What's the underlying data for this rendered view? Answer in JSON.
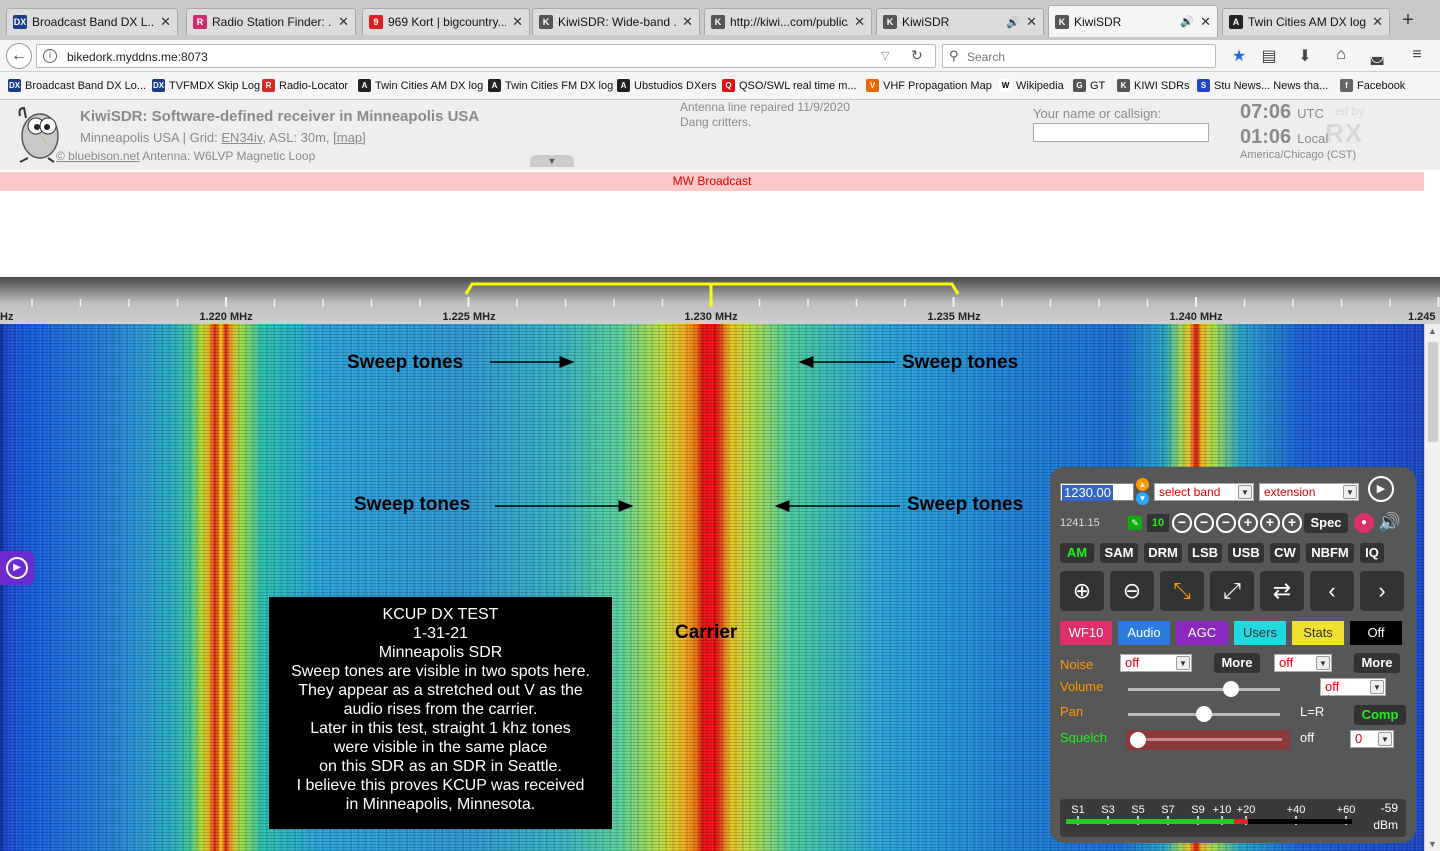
{
  "browser": {
    "tabs": [
      {
        "title": "Broadcast Band DX L...",
        "icon_color": "#1a3e8a",
        "icon_glyph": "DX"
      },
      {
        "title": "Radio Station Finder: ...",
        "icon_color": "#d02a6a",
        "icon_glyph": "R"
      },
      {
        "title": "969 Kort | bigcountry...",
        "icon_color": "#e02020",
        "icon_glyph": "9"
      },
      {
        "title": "KiwiSDR: Wide-band ...",
        "icon_color": "#555555",
        "icon_glyph": "K"
      },
      {
        "title": "http://kiwi...com/public/",
        "icon_color": "#555555",
        "icon_glyph": "K"
      },
      {
        "title": "KiwiSDR",
        "icon_color": "#555555",
        "icon_glyph": "K",
        "audio": true
      },
      {
        "title": "KiwiSDR",
        "icon_color": "#555555",
        "icon_glyph": "K",
        "audio": true,
        "active": true
      },
      {
        "title": "Twin Cities AM DX log",
        "icon_color": "#222222",
        "icon_glyph": "A"
      }
    ],
    "url": "bikedork.myddns.me:8073",
    "search_placeholder": "Search",
    "bookmarks": [
      {
        "label": "Broadcast Band DX Lo...",
        "icon_color": "#1a3e8a",
        "icon_glyph": "DX"
      },
      {
        "label": "TVFMDX Skip Log",
        "icon_color": "#1a3e8a",
        "icon_glyph": "DX"
      },
      {
        "label": "Radio-Locator",
        "icon_color": "#d02a2a",
        "icon_glyph": "R"
      },
      {
        "label": "Twin Cities AM DX log",
        "icon_color": "#222222",
        "icon_glyph": "A"
      },
      {
        "label": "Twin Cities FM DX log",
        "icon_color": "#222222",
        "icon_glyph": "A"
      },
      {
        "label": "Ubstudios DXers",
        "icon_color": "#222222",
        "icon_glyph": "A"
      },
      {
        "label": "QSO/SWL real time m...",
        "icon_color": "#dd1111",
        "icon_glyph": "Q"
      },
      {
        "label": "VHF Propagation Map",
        "icon_color": "#ee6600",
        "icon_glyph": "V"
      },
      {
        "label": "Wikipedia",
        "icon_color": "#ffffff",
        "icon_glyph": "W"
      },
      {
        "label": "GT",
        "icon_color": "#555555",
        "icon_glyph": "G"
      },
      {
        "label": "KIWI SDRs",
        "icon_color": "#555555",
        "icon_glyph": "K"
      },
      {
        "label": "Stu News... News tha...",
        "icon_color": "#2244cc",
        "icon_glyph": "S"
      },
      {
        "label": "Facebook",
        "icon_color": "#666666",
        "icon_glyph": "f"
      }
    ]
  },
  "kiwi": {
    "title": "KiwiSDR: Software-defined receiver in Minneapolis USA",
    "loc_prefix": "Minneapolis USA | Grid: ",
    "grid": "EN34iv",
    "asl": ", ASL: 30m, ",
    "map_link": "[map]",
    "copyright": "© bluebison.net",
    "antenna": " Antenna: W6LVP Magnetic Loop",
    "note_line1": "Antenna line repaired 11/9/2020",
    "note_line2": "Dang critters.",
    "name_label": "Your name or callsign:",
    "utc_time": "07:06",
    "utc_label": "UTC",
    "local_time": "01:06",
    "local_label": "Local",
    "timezone": "America/Chicago (CST)",
    "openrx_by": "ed by",
    "openrx_logo": "RX",
    "band_label": "MW Broadcast"
  },
  "scale": {
    "labels": [
      {
        "text": "Hz"
      },
      {
        "text": "1.220 MHz"
      },
      {
        "text": "1.225 MHz"
      },
      {
        "text": "1.230 MHz"
      },
      {
        "text": "1.235 MHz"
      },
      {
        "text": "1.240 MHz"
      },
      {
        "text": "1.245"
      }
    ]
  },
  "annotations": {
    "sweep_1": "Sweep tones",
    "sweep_2": "Sweep tones",
    "sweep_3": "Sweep tones",
    "sweep_4": "Sweep tones",
    "carrier": "Carrier",
    "box_lines": [
      "KCUP DX TEST",
      "1-31-21",
      "Minneapolis SDR",
      "Sweep tones are visible in two spots here.",
      "They appear as a stretched out V as the",
      "audio rises from the carrier.",
      "Later in this test, straight 1 khz tones",
      "were visible in the same place",
      "on this SDR as an SDR in Seattle.",
      "I believe this proves KCUP was received",
      "in Minneapolis, Minnesota."
    ]
  },
  "panel": {
    "frequency": "1230.00",
    "select_band": "select band",
    "extension": "extension",
    "freq2": "1241.15",
    "zoom_level": "10",
    "spec": "Spec",
    "modes": [
      "AM",
      "SAM",
      "DRM",
      "LSB",
      "USB",
      "CW",
      "NBFM",
      "IQ"
    ],
    "active_mode": "AM",
    "tabs": [
      {
        "label": "WF10",
        "bg": "#e0306a",
        "fg": "#ffffff"
      },
      {
        "label": "Audio",
        "bg": "#2a7ae0",
        "fg": "#ffffff"
      },
      {
        "label": "AGC",
        "bg": "#8a28c0",
        "fg": "#ffffff"
      },
      {
        "label": "Users",
        "bg": "#22d8e0",
        "fg": "#333333"
      },
      {
        "label": "Stats",
        "bg": "#f0e030",
        "fg": "#333333"
      },
      {
        "label": "Off",
        "bg": "#000000",
        "fg": "#ffffff"
      }
    ],
    "noise_label": "Noise",
    "noise_value": "off",
    "more1": "More",
    "noise2_value": "off",
    "more2": "More",
    "volume_label": "Volume",
    "volume_level": 0.68,
    "vol_select": "off",
    "pan_label": "Pan",
    "pan_level": 0.5,
    "lr_label": "L=R",
    "comp": "Comp",
    "squelch_label": "Squelch",
    "squelch_state": "off",
    "squelch_value": "0",
    "smeter_labels": [
      "S1",
      "S3",
      "S5",
      "S7",
      "S9",
      "+10",
      "+20",
      "+40",
      "+60"
    ],
    "smeter_reading": "-59",
    "smeter_unit": "dBm"
  },
  "colors": {
    "panel_bg": "#575757",
    "band_bar_bg": "#ffc8c8",
    "band_bar_text": "#e00000",
    "passband": "#ffff00",
    "active_green": "#22ee22"
  }
}
